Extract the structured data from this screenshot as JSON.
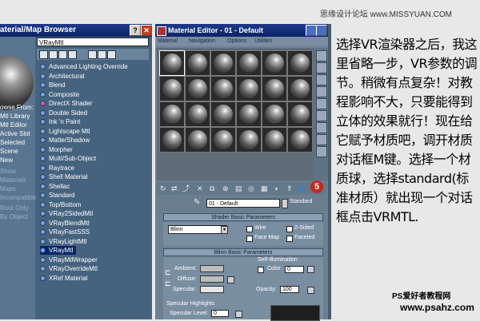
{
  "watermark_top": "思缘设计论坛 www.MISSYUAN.COM",
  "browser": {
    "title": "aterial/Map Browser",
    "name_field": "VRayMtl",
    "side_items": [
      "owse From:",
      "Mtl Library",
      "Mtl Editor",
      "Active Slot",
      "Selected",
      "Scene",
      "New"
    ],
    "side_items_dim": [
      "Show",
      "Materials",
      "Maps",
      "Incompatible"
    ],
    "side_items_dim2": [
      "Root Only",
      "By Object"
    ],
    "materials": [
      "Advanced Lighting Override",
      "Architectural",
      "Blend",
      "Composite",
      "DirectX Shader",
      "Double Sided",
      "Ink 'n Paint",
      "Lightscape Mtl",
      "Matte/Shadow",
      "Morpher",
      "Multi/Sub-Object",
      "Raytrace",
      "Shell Material",
      "Shellac",
      "Standard",
      "Top/Bottom",
      "VRay2SidedMtl",
      "VRayBlendMtl",
      "VRayFastSSS",
      "VRayLightMtl",
      "VRayMtl",
      "VRayMtlWrapper",
      "VRayOverrideMtl",
      "XRef Material"
    ],
    "selected_index": 20
  },
  "editor": {
    "title": "Material Editor - 01 - Default",
    "menu": [
      "Material",
      "Navigation",
      "Options",
      "Utilities"
    ],
    "badge": "5",
    "material_name": "01 - Default",
    "material_type": "Standard",
    "shader_params": {
      "header": "Shader Basic Parameters",
      "shader": "Blinn",
      "wire": "Wire",
      "two_sided": "2-Sided",
      "face_map": "Face Map",
      "faceted": "Faceted"
    },
    "blinn_params": {
      "header": "Blinn Basic Parameters",
      "self_illum": "Self-Illumination",
      "color": "Color",
      "color_val": "0",
      "ambient": "Ambient:",
      "diffuse": "Diffuse:",
      "specular": "Specular:",
      "opacity": "Opacity:",
      "opacity_val": "100",
      "spec_highlights": "Specular Highlights",
      "spec_level": "Specular Level:",
      "spec_level_val": "0"
    }
  },
  "tutorial_text": "选择VR渲染器之后，我这里省略一步，VR参数的调节。稍微有点复杂！对教程影响不大，只要能得到立体的效果就行！现在给它赋予材质吧，调开材质对话框M键。选择一个材质球，选择standard(标准材质）就出现一个对话框点击VRMTL.",
  "footer": {
    "brand": "PS爱好者教程网",
    "url": "www.psahz.com"
  }
}
